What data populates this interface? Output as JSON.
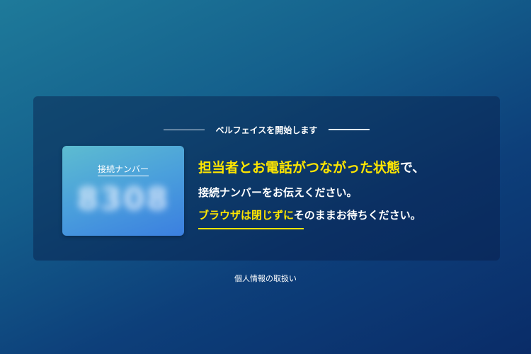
{
  "card": {
    "header_title": "ベルフェイスを開始します",
    "connection_label": "接続ナンバー",
    "connection_number": "8308",
    "line1_highlight": "担当者とお電話がつながった状態",
    "line1_rest": "で、",
    "line2": "接続ナンバーをお伝えください。",
    "line3_highlight": "ブラウザは閉じずに",
    "line3_rest": "そのままお待ちください。"
  },
  "footer": {
    "privacy_link": "個人情報の取扱い"
  },
  "colors": {
    "accent_yellow": "#ffe600",
    "background_top": "#1e7a9a",
    "background_bottom": "#0a2c68",
    "number_box": "#4a9fdc"
  }
}
